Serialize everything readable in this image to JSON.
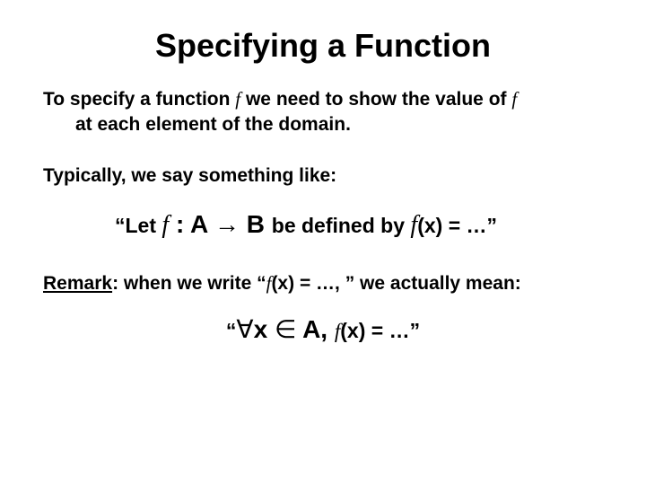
{
  "title": "Specifying a Function",
  "p1_a": "To specify a function ",
  "f": "f",
  "p1_b": " we need to show the value of ",
  "p1_c": "at each element of the domain.",
  "p2": "Typically, we say something like:",
  "let_a": "“Let  ",
  "let_b": " : A ",
  "arrow": "→",
  "let_c": " B ",
  "let_d": "be defined by  ",
  "let_e": "(x) = …”",
  "remark_label": "Remark",
  "remark_a": ": when we write “",
  "remark_b": "(x) = …, ” we actually mean:",
  "forall": "∀",
  "forall_a": "“",
  "forall_b": "x ",
  "in": "∈",
  "forall_c": " A, ",
  "forall_d": "(x) = …”"
}
